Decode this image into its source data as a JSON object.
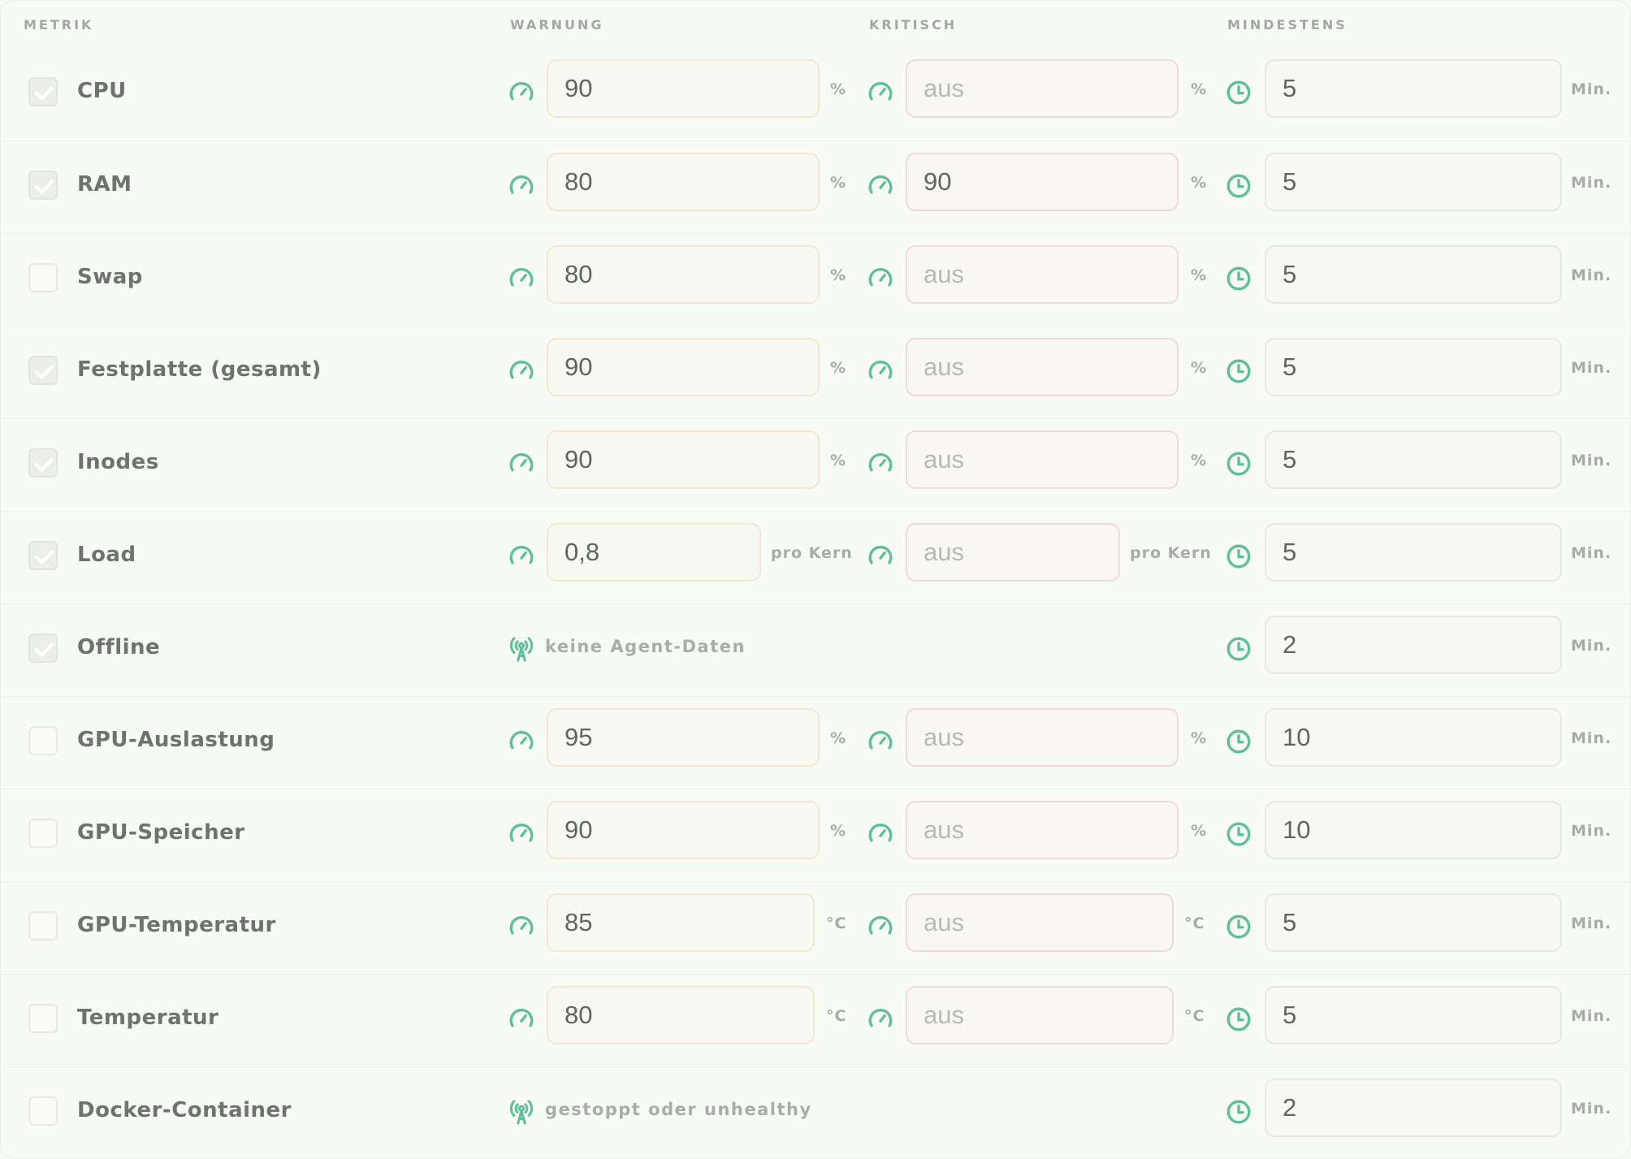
{
  "headers": {
    "metric": "METRIK",
    "warning": "WARNUNG",
    "critical": "KRITISCH",
    "minimum": "MINDESTENS"
  },
  "accent_color": "#5fbf99",
  "rows": [
    {
      "metric": "CPU",
      "checked": true,
      "type": "threshold",
      "warn": "90",
      "warn_unit": "%",
      "crit": "aus",
      "crit_unit": "%",
      "min": "5",
      "min_unit": "Min."
    },
    {
      "metric": "RAM",
      "checked": true,
      "type": "threshold",
      "warn": "80",
      "warn_unit": "%",
      "crit": "90",
      "crit_unit": "%",
      "min": "5",
      "min_unit": "Min."
    },
    {
      "metric": "Swap",
      "checked": false,
      "type": "threshold",
      "warn": "80",
      "warn_unit": "%",
      "crit": "aus",
      "crit_unit": "%",
      "min": "5",
      "min_unit": "Min."
    },
    {
      "metric": "Festplatte (gesamt)",
      "checked": true,
      "type": "threshold",
      "warn": "90",
      "warn_unit": "%",
      "crit": "aus",
      "crit_unit": "%",
      "min": "5",
      "min_unit": "Min."
    },
    {
      "metric": "Inodes",
      "checked": true,
      "type": "threshold",
      "warn": "90",
      "warn_unit": "%",
      "crit": "aus",
      "crit_unit": "%",
      "min": "5",
      "min_unit": "Min."
    },
    {
      "metric": "Load",
      "checked": true,
      "type": "threshold",
      "warn": "0,8",
      "warn_unit": "pro Kern",
      "crit": "aus",
      "crit_unit": "pro Kern",
      "min": "5",
      "min_unit": "Min."
    },
    {
      "metric": "Offline",
      "checked": true,
      "type": "event",
      "note": "keine Agent-Daten",
      "min": "2",
      "min_unit": "Min."
    },
    {
      "metric": "GPU-Auslastung",
      "checked": false,
      "type": "threshold",
      "warn": "95",
      "warn_unit": "%",
      "crit": "aus",
      "crit_unit": "%",
      "min": "10",
      "min_unit": "Min."
    },
    {
      "metric": "GPU-Speicher",
      "checked": false,
      "type": "threshold",
      "warn": "90",
      "warn_unit": "%",
      "crit": "aus",
      "crit_unit": "%",
      "min": "10",
      "min_unit": "Min."
    },
    {
      "metric": "GPU-Temperatur",
      "checked": false,
      "type": "threshold",
      "warn": "85",
      "warn_unit": "°C",
      "crit": "aus",
      "crit_unit": "°C",
      "min": "5",
      "min_unit": "Min."
    },
    {
      "metric": "Temperatur",
      "checked": false,
      "type": "threshold",
      "warn": "80",
      "warn_unit": "°C",
      "crit": "aus",
      "crit_unit": "°C",
      "min": "5",
      "min_unit": "Min."
    },
    {
      "metric": "Docker-Container",
      "checked": false,
      "type": "event",
      "note": "gestoppt oder unhealthy",
      "min": "2",
      "min_unit": "Min."
    }
  ]
}
